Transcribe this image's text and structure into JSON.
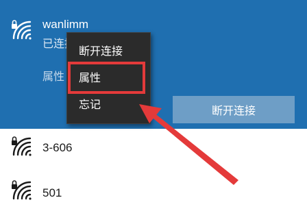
{
  "networks": [
    {
      "name": "wanlimm",
      "status": "已连接，安全",
      "icon": "wifi-secured-icon",
      "selected": true
    },
    {
      "name": "3-606",
      "icon": "wifi-secured-icon"
    },
    {
      "name": "501",
      "icon": "wifi-secured-icon"
    }
  ],
  "selected_network": {
    "properties_label": "属性",
    "disconnect_label": "断开连接"
  },
  "context_menu": {
    "items": [
      "断开连接",
      "属性",
      "忘记"
    ]
  },
  "annotation": {
    "highlight_color": "#e43a3a",
    "highlighted_item": "属性"
  },
  "colors": {
    "selected_bg": "#1f6fb0",
    "menu_bg": "#2b2b2b",
    "button_bg": "#6e9ec6"
  }
}
